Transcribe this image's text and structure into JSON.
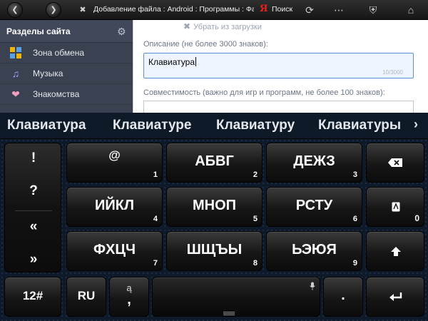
{
  "browser": {
    "title": "Добавление файла : Android : Программы : Фа",
    "search_logo": "Я",
    "search_label": "Поиск"
  },
  "sidebar": {
    "title": "Разделы сайта",
    "items": [
      {
        "label": "Зона обмена",
        "icon": "exchange-zone-icon"
      },
      {
        "label": "Музыка",
        "icon": "music-note-icon"
      },
      {
        "label": "Знакомства",
        "icon": "heart-icon"
      }
    ]
  },
  "form": {
    "top_link": "Убрать из загрузки",
    "description_label": "Описание (не более 3000 знаков):",
    "description_value": "Клавиатура",
    "description_counter": "10/3000",
    "compat_label": "Совместимость (важно для игр и программ, не более 100 знаков):",
    "compat_value": ""
  },
  "keyboard": {
    "suggestions": [
      "Клавиатура",
      "Клавиатуре",
      "Клавиатуру",
      "Клавиатуры"
    ],
    "punct": [
      "!",
      "?",
      "«",
      "»"
    ],
    "rows": [
      [
        {
          "label": "@",
          "num": "1"
        },
        {
          "label": "АБВГ",
          "num": "2"
        },
        {
          "label": "ДЕЖЗ",
          "num": "3"
        }
      ],
      [
        {
          "label": "ИЙКЛ",
          "num": "4"
        },
        {
          "label": "МНОП",
          "num": "5"
        },
        {
          "label": "РСТУ",
          "num": "6"
        }
      ],
      [
        {
          "label": "ФХЦЧ",
          "num": "7"
        },
        {
          "label": "ШЩЪЫ",
          "num": "8"
        },
        {
          "label": "ЬЭЮЯ",
          "num": "9"
        }
      ]
    ],
    "side": {
      "zero_label": "0"
    },
    "bottom": {
      "symbols_label": "12#",
      "lang_label": "RU",
      "comma_label": ",",
      "comma_sub": "ą",
      "period_label": "."
    }
  }
}
